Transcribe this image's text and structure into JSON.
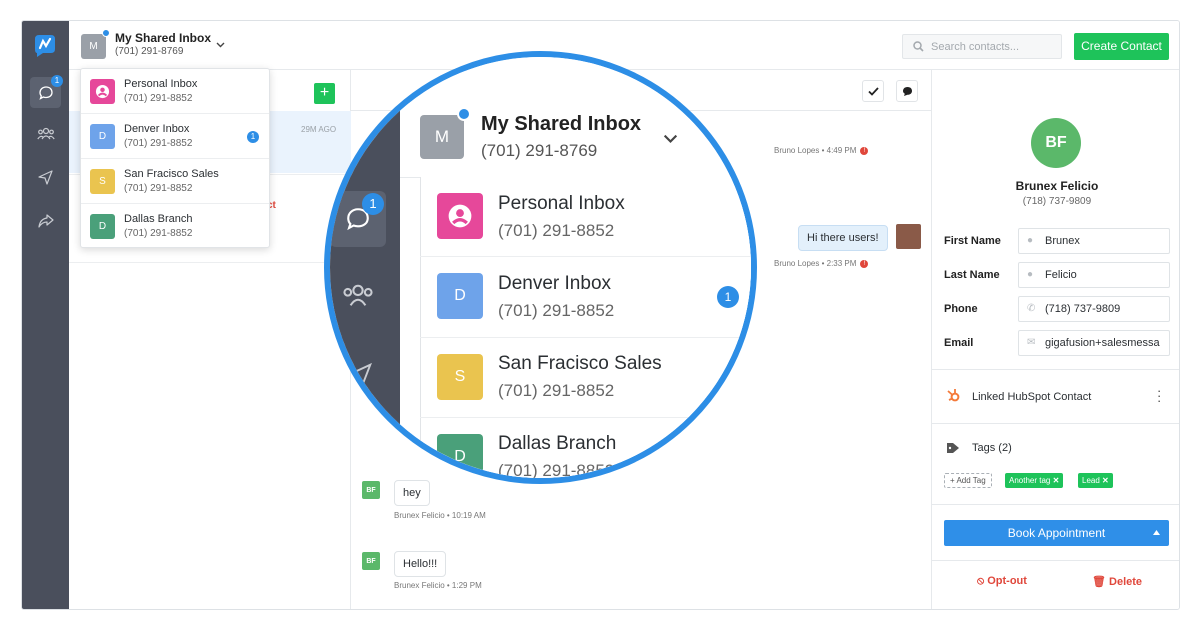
{
  "header": {
    "inbox_initial": "M",
    "inbox_title": "My Shared Inbox",
    "inbox_phone": "(701) 291-8769",
    "search_placeholder": "Search contacts...",
    "create_button": "Create Contact"
  },
  "nav": {
    "conversations_badge": "1",
    "icons": [
      "logo-icon",
      "chat-icon",
      "users-icon",
      "send-icon",
      "share-icon"
    ]
  },
  "inbox_dropdown": [
    {
      "initial": "",
      "name": "Personal Inbox",
      "phone": "(701) 291-8852",
      "color": "#e6489a",
      "badge": ""
    },
    {
      "initial": "D",
      "name": "Denver Inbox",
      "phone": "(701) 291-8852",
      "color": "#6ea3ea",
      "badge": "1"
    },
    {
      "initial": "S",
      "name": "San Fracisco Sales",
      "phone": "(701) 291-8852",
      "color": "#eac44f",
      "badge": ""
    },
    {
      "initial": "D",
      "name": "Dallas Branch",
      "phone": "(701) 291-8852",
      "color": "#4aa07a",
      "badge": ""
    }
  ],
  "conversation_list": {
    "time_ago": "29M AGO",
    "opt_out_fragment": "ntact"
  },
  "chat": {
    "messages": [
      {
        "meta": "Bruno Lopes • 4:49 PM"
      },
      {
        "text": "Hi there users!",
        "meta": "Bruno Lopes • 2:33 PM"
      },
      {
        "initials": "BF",
        "text": "hey",
        "meta": "Brunex Felicio • 10:19 AM"
      },
      {
        "initials": "BF",
        "text": "Hello!!!",
        "meta": "Brunex Felicio • 1:29 PM"
      }
    ]
  },
  "contact": {
    "initials": "BF",
    "name": "Brunex Felicio",
    "phone": "(718) 737-9809",
    "fields": {
      "first_name_label": "First Name",
      "first_name": "Brunex",
      "last_name_label": "Last Name",
      "last_name": "Felicio",
      "phone_label": "Phone",
      "phone_value": "(718) 737-9809",
      "email_label": "Email",
      "email_value": "gigafusion+salesmessa"
    },
    "hubspot_label": "Linked HubSpot Contact",
    "tags_label": "Tags (2)",
    "add_tag": "+ Add Tag",
    "tags": [
      "Another tag",
      "Lead"
    ],
    "book_button": "Book Appointment",
    "opt_out": "Opt-out",
    "delete": "Delete"
  },
  "colors": {
    "brand_blue": "#2d8ee6",
    "green": "#1ec35a",
    "danger": "#e0473b",
    "nav_bg": "#4a4f5c"
  }
}
